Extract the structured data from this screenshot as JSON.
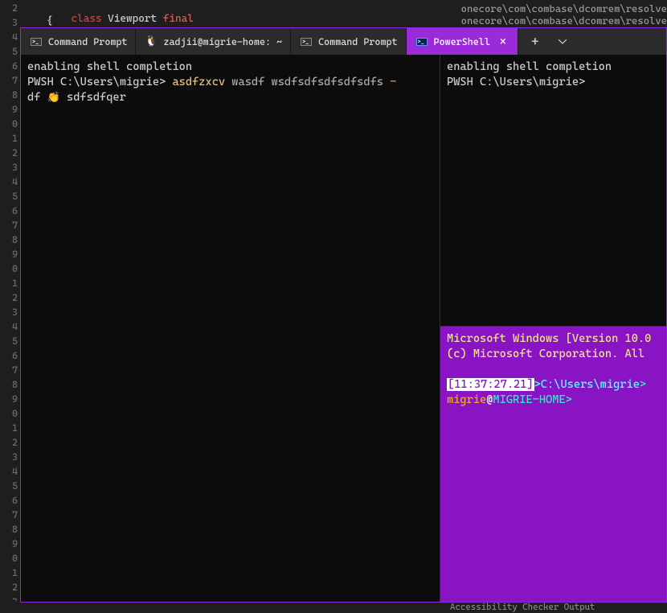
{
  "editor": {
    "code_line1_kw": "class",
    "code_line1_name": " Viewport ",
    "code_line1_final": "final",
    "code_line2": "{",
    "bg_log1": "onecore\\com\\combase\\dcomrem\\resolve",
    "bg_log2": "onecore\\com\\combase\\dcomrem\\resolve"
  },
  "tabs": {
    "t1": "Command Prompt",
    "t2": "zadjii@migrie-home: ~",
    "t3": "Command Prompt",
    "t4": "PowerShell"
  },
  "left_pane": {
    "l1": "enabling shell completion",
    "prompt": "PWSH C:\\Users\\migrie> ",
    "cmd": "asdfzxcv",
    "args": " wasdf wsdfsdfsdfsdfsdfs ",
    "dash": "-",
    "l3a": "df ",
    "emoji": "👏",
    "l3b": " sdfsdfqer"
  },
  "right_top": {
    "l1": "enabling shell completion",
    "prompt": "PWSH C:\\Users\\migrie>"
  },
  "right_bottom": {
    "ver": "Microsoft Windows [Version 10.0",
    "copy": "(c) Microsoft Corporation. All ",
    "time": "[11:37:27.21]",
    "gt1": ">",
    "path": "C:\\Users\\migrie",
    "gt2": ">",
    "user": "migrie",
    "at": "@",
    "host": "MIGRIE-HOME",
    "gt3": ">"
  },
  "bottom": {
    "text": "Accessibility Checker    Output"
  }
}
